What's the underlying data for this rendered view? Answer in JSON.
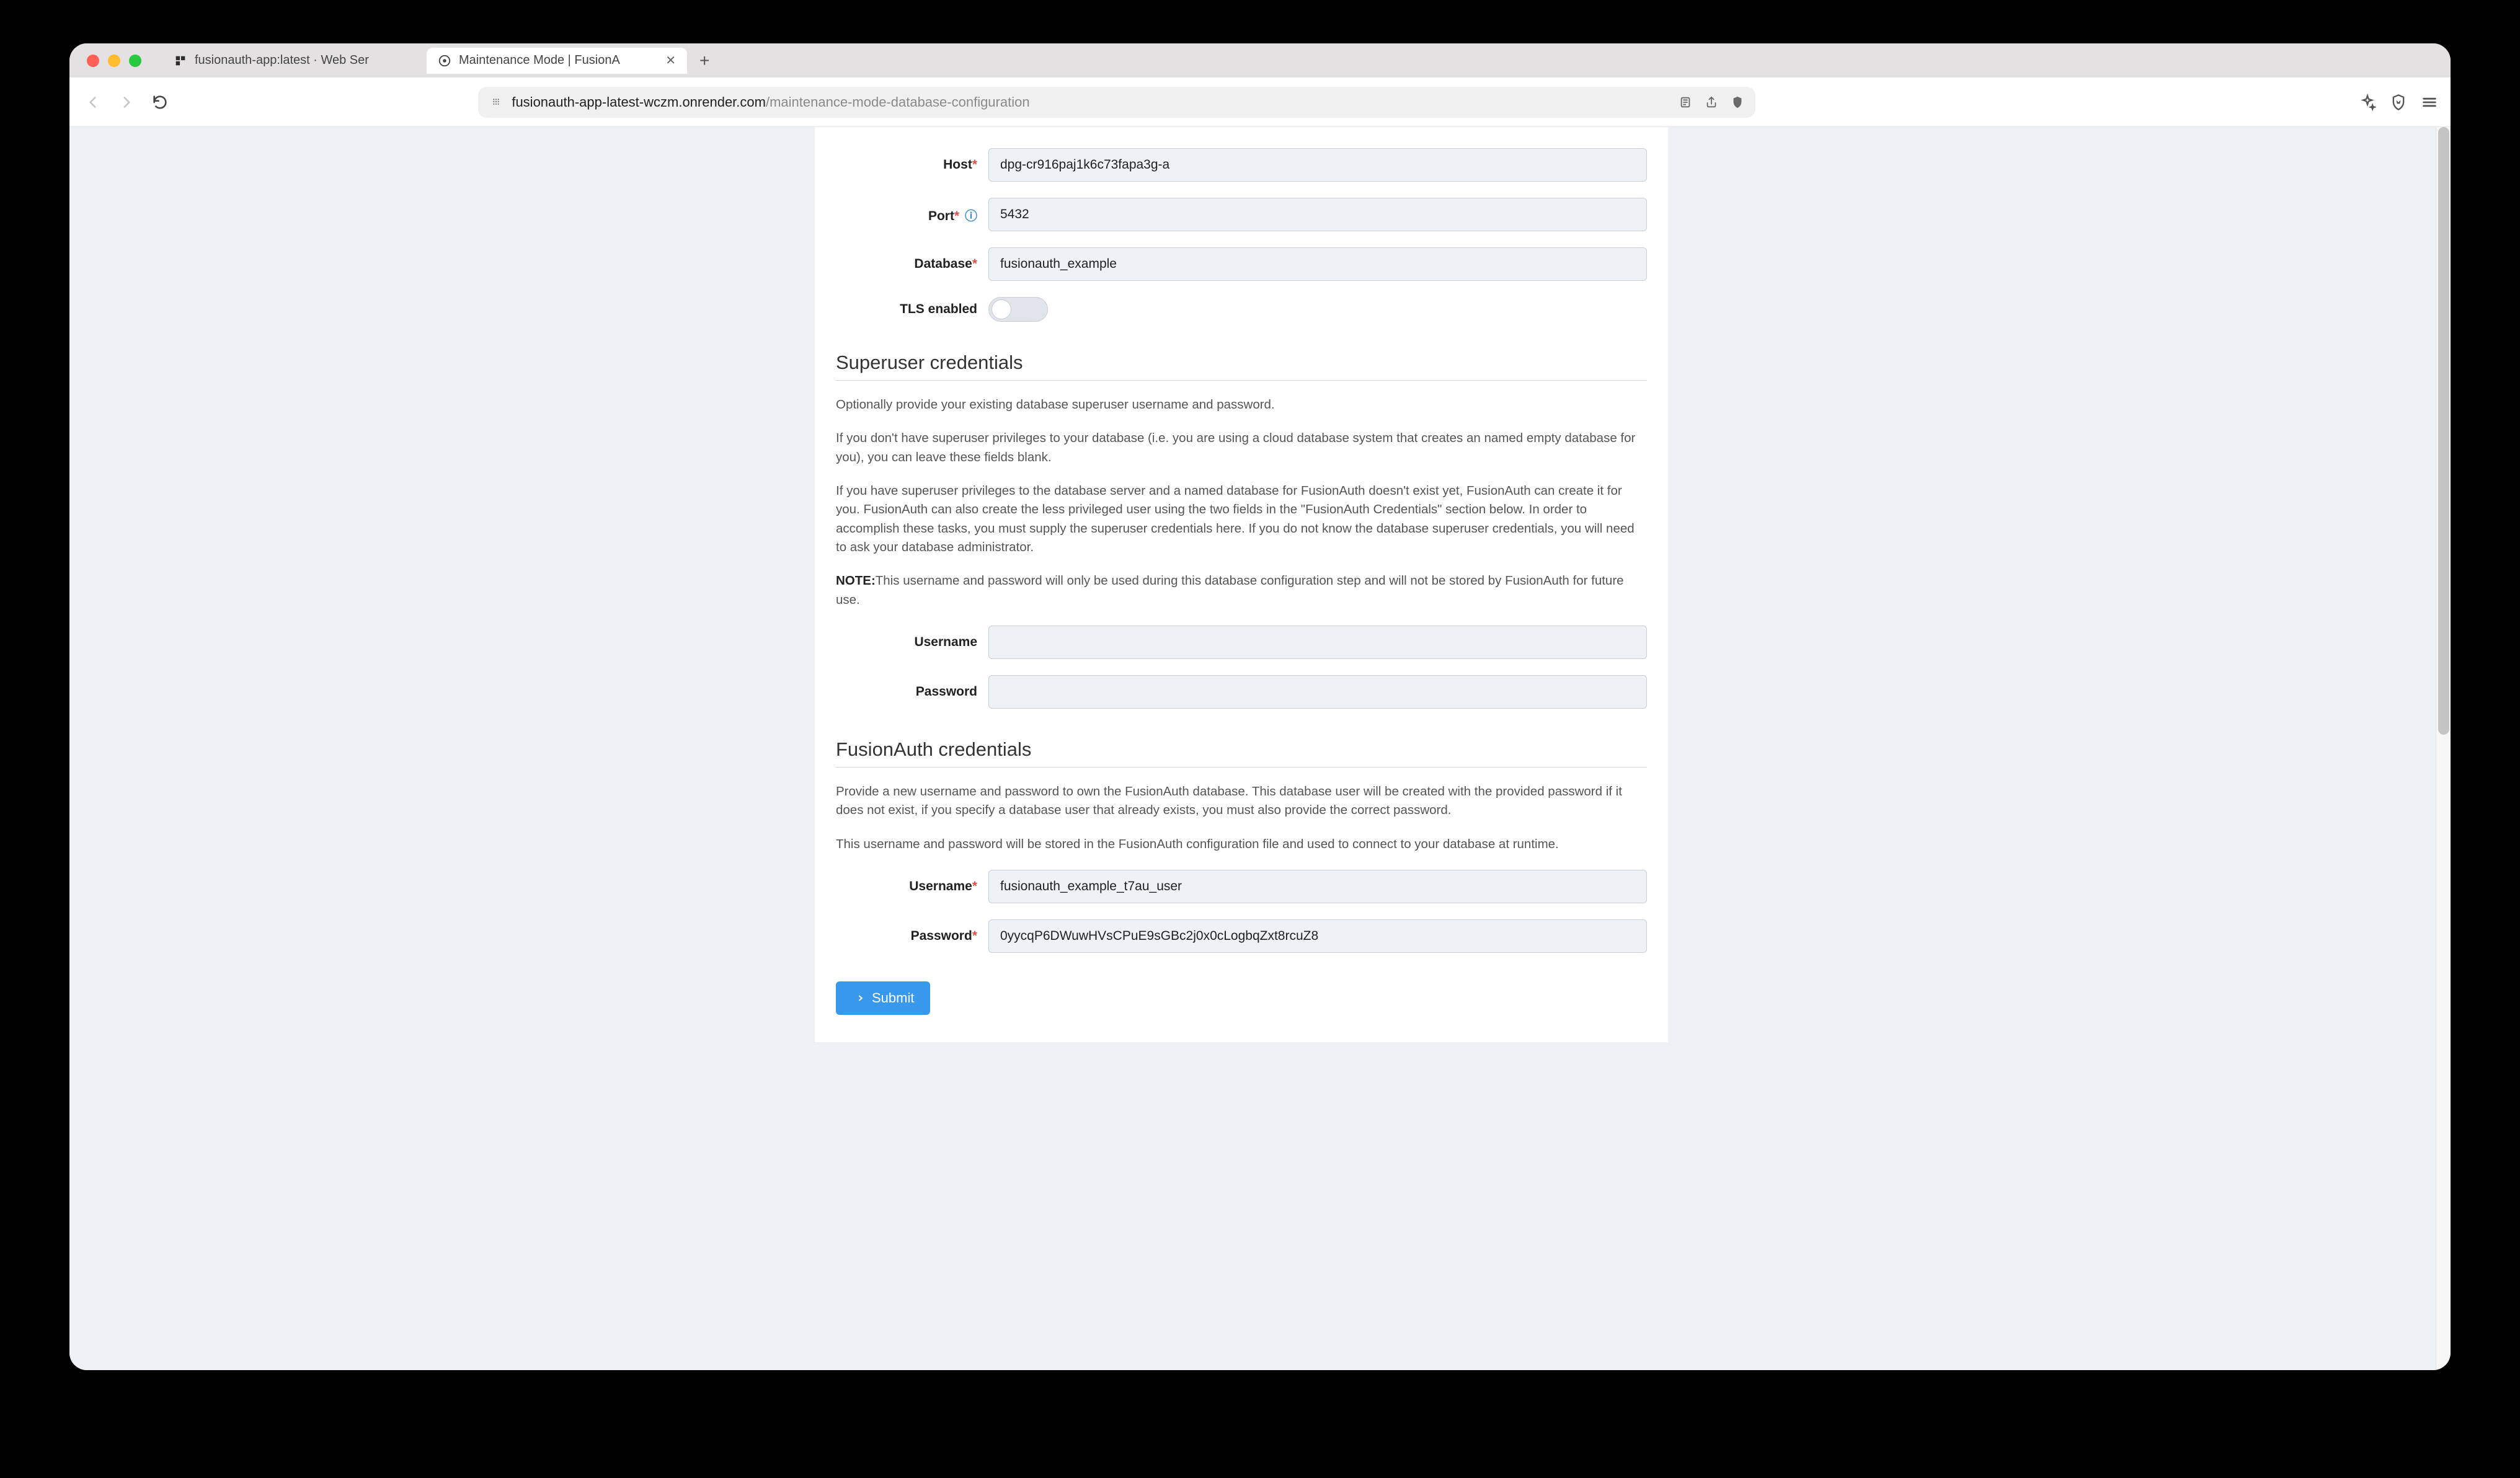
{
  "browser": {
    "tabs": [
      {
        "title": "fusionauth-app:latest  ·  Web Ser",
        "active": false
      },
      {
        "title": "Maintenance Mode | FusionA",
        "active": true
      }
    ],
    "url_domain": "fusionauth-app-latest-wczm.onrender.com",
    "url_path": "/maintenance-mode-database-configuration"
  },
  "help_label": "Help",
  "db": {
    "host_label": "Host",
    "host_value": "dpg-cr916paj1k6c73fapa3g-a",
    "port_label": "Port",
    "port_value": "5432",
    "database_label": "Database",
    "database_value": "fusionauth_example",
    "tls_label": "TLS enabled"
  },
  "superuser": {
    "heading": "Superuser credentials",
    "p1": "Optionally provide your existing database superuser username and password.",
    "p2": "If you don't have superuser privileges to your database (i.e. you are using a cloud database system that creates an named empty database for you), you can leave these fields blank.",
    "p3": "If you have superuser privileges to the database server and a named database for FusionAuth doesn't exist yet, FusionAuth can create it for you. FusionAuth can also create the less privileged user using the two fields in the \"FusionAuth Credentials\" section below. In order to accomplish these tasks, you must supply the superuser credentials here. If you do not know the database superuser credentials, you will need to ask your database administrator.",
    "note_label": "NOTE:",
    "note_text": "This username and password will only be used during this database configuration step and will not be stored by FusionAuth for future use.",
    "username_label": "Username",
    "username_value": "",
    "password_label": "Password",
    "password_value": ""
  },
  "fusionauth": {
    "heading": "FusionAuth credentials",
    "p1": "Provide a new username and password to own the FusionAuth database. This database user will be created with the provided password if it does not exist, if you specify a database user that already exists, you must also provide the correct password.",
    "p2": "This username and password will be stored in the FusionAuth configuration file and used to connect to your database at runtime.",
    "username_label": "Username",
    "username_value": "fusionauth_example_t7au_user",
    "password_label": "Password",
    "password_value": "0yycqP6DWuwHVsCPuE9sGBc2j0x0cLogbqZxt8rcuZ8"
  },
  "submit_label": "Submit"
}
